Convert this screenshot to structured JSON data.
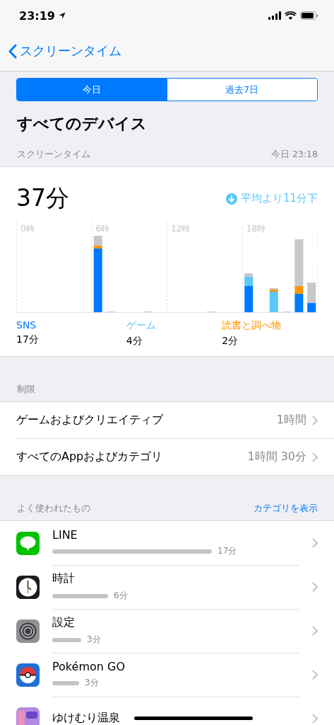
{
  "status_bar": {
    "time": "23:19"
  },
  "nav": {
    "back_label": "スクリーンタイム"
  },
  "segments": [
    {
      "label": "今日",
      "selected": true
    },
    {
      "label": "過去7日",
      "selected": false
    }
  ],
  "title": "すべてのデバイス",
  "summary_header": {
    "label": "スクリーンタイム",
    "updated": "今日 23:18"
  },
  "summary": {
    "total": "37分",
    "comparison": "平均より11分下",
    "hour_labels": [
      "0時",
      "6時",
      "12時",
      "18時"
    ],
    "categories": [
      {
        "name": "SNS",
        "time": "17分",
        "color": "#007aff"
      },
      {
        "name": "ゲーム",
        "time": "4分",
        "color": "#5ac8fa"
      },
      {
        "name": "読書と調べ物",
        "time": "2分",
        "color": "#ff9500"
      }
    ]
  },
  "limits": {
    "header": "制限",
    "rows": [
      {
        "label": "ゲームおよびクリエイティブ",
        "value": "1時間"
      },
      {
        "label": "すべてのAppおよびカテゴリ",
        "value": "1時間 30分"
      }
    ]
  },
  "most_used": {
    "header": "よく使われたもの",
    "action": "カテゴリを表示",
    "apps": [
      {
        "kind": "line",
        "name": "LINE",
        "time": "17分"
      },
      {
        "kind": "clock",
        "name": "時計",
        "time": "6分"
      },
      {
        "kind": "settings",
        "name": "設定",
        "time": "3分"
      },
      {
        "kind": "ball",
        "name": "Pokémon GO",
        "time": "3分"
      },
      {
        "kind": "game",
        "name": "ゆけむり温泉"
      }
    ]
  }
}
